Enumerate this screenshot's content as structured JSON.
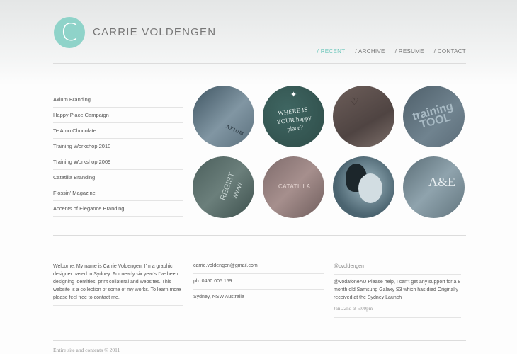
{
  "header": {
    "logo_letter": "C",
    "site_name": "CARRIE VOLDENGEN",
    "nav": [
      {
        "label": "/ RECENT",
        "active": true
      },
      {
        "label": "/ ARCHIVE",
        "active": false
      },
      {
        "label": "/ RESUME",
        "active": false
      },
      {
        "label": "/ CONTACT",
        "active": false
      }
    ]
  },
  "projects": [
    "Axium Branding",
    "Happy Place Campaign",
    "Te Amo Chocolate",
    "Training Workshop 2010",
    "Training Workshop 2009",
    "Catatilla Branding",
    "Flossin' Magazine",
    "Accents of Elegance Branding"
  ],
  "thumbnails": [
    {
      "name": "axium-thumb",
      "caption": "AXIUM"
    },
    {
      "name": "happy-place-thumb",
      "caption": "WHERE IS YOUR happy place?"
    },
    {
      "name": "te-amo-thumb",
      "caption": ""
    },
    {
      "name": "training-tool-thumb",
      "caption": "training TOOL"
    },
    {
      "name": "registration-thumb",
      "caption": "REGIST www."
    },
    {
      "name": "catatilla-thumb",
      "caption": "CATATILLA"
    },
    {
      "name": "portrait-thumb",
      "caption": ""
    },
    {
      "name": "accents-thumb",
      "caption": "A&E"
    }
  ],
  "about": "Welcome. My name is Carrie Voldengen. I'm a graphic designer based in Sydney. For nearly six year's I've been designing identities, print collateral and websites. This website is a collection of some of my works. To learn more please feel free to contact me.",
  "contact": {
    "email": "carrie.voldengen@gmail.com",
    "phone": "ph: 0450 005 159",
    "location": "Sydney, NSW Australia"
  },
  "twitter": {
    "handle": "@cvoldengen",
    "tweet": "@VodafoneAU Please help, I can't get any support for a 8 month old Samsung Galaxy S3 which has died Originally received at the Sydney Launch",
    "time": "Jan 22nd at 5:09pm"
  },
  "footer": "Entire site and contents © 2011",
  "colors": {
    "accent": "#8fd3c9",
    "nav_active": "#6cc7bb"
  }
}
